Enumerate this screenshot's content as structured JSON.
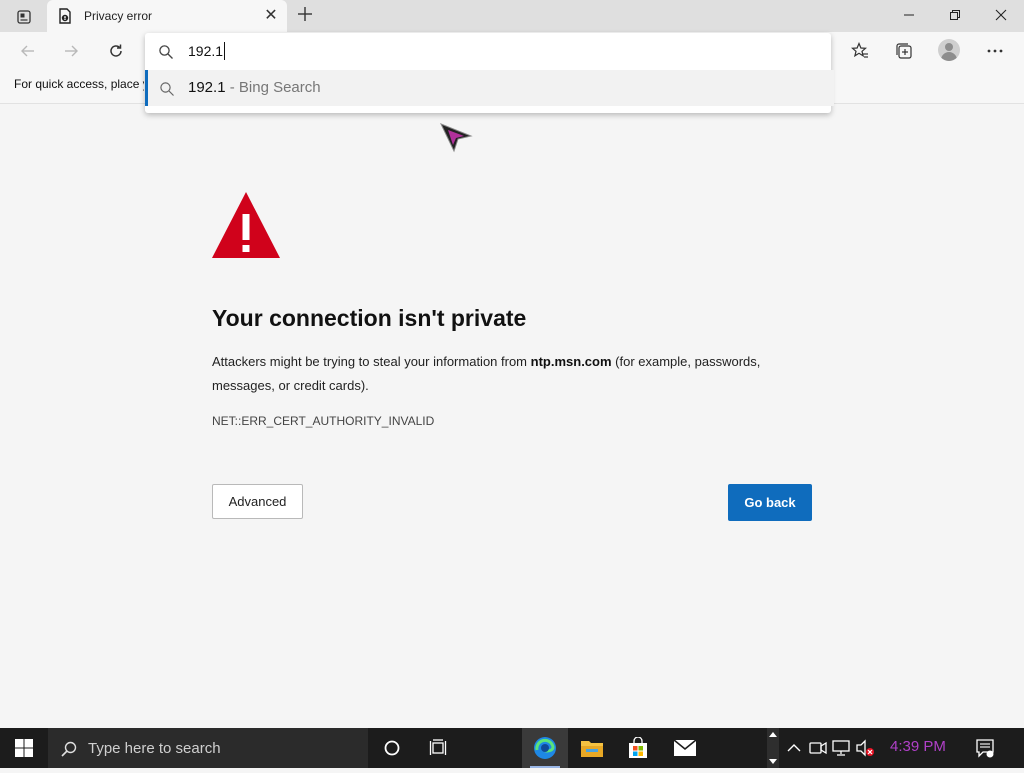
{
  "tab": {
    "title": "Privacy error"
  },
  "omnibox": {
    "input_value": "192.1",
    "suggestion_query": "192.1",
    "suggestion_separator": " - ",
    "suggestion_source": "Bing Search"
  },
  "favorites_bar": {
    "text": "For quick access, place y"
  },
  "error_page": {
    "heading": "Your connection isn't private",
    "desc_prefix": "Attackers might be trying to steal your information from ",
    "desc_domain": "ntp.msn.com",
    "desc_suffix": " (for example, passwords, messages, or credit cards).",
    "error_code": "NET::ERR_CERT_AUTHORITY_INVALID",
    "advanced_label": "Advanced",
    "go_back_label": "Go back"
  },
  "taskbar": {
    "search_placeholder": "Type here to search",
    "time": "4:39 PM"
  },
  "colors": {
    "accent": "#0f6cbd",
    "warning_red": "#d0021b",
    "taskbar_bg": "#1c1c1c",
    "clock_text": "#b040c8"
  },
  "icons": [
    "tab-actions-icon",
    "privacy-error-icon",
    "close-icon",
    "plus-icon",
    "minimize-icon",
    "restore-icon",
    "back-arrow-icon",
    "forward-arrow-icon",
    "refresh-icon",
    "search-icon",
    "favorites-icon",
    "collections-icon",
    "profile-icon",
    "more-icon",
    "warning-icon",
    "windows-icon",
    "task-view-icon",
    "edge-icon",
    "file-explorer-icon",
    "store-icon",
    "mail-icon",
    "chevron-up-icon",
    "camera-icon",
    "network-icon",
    "volume-muted-icon",
    "notification-icon"
  ]
}
